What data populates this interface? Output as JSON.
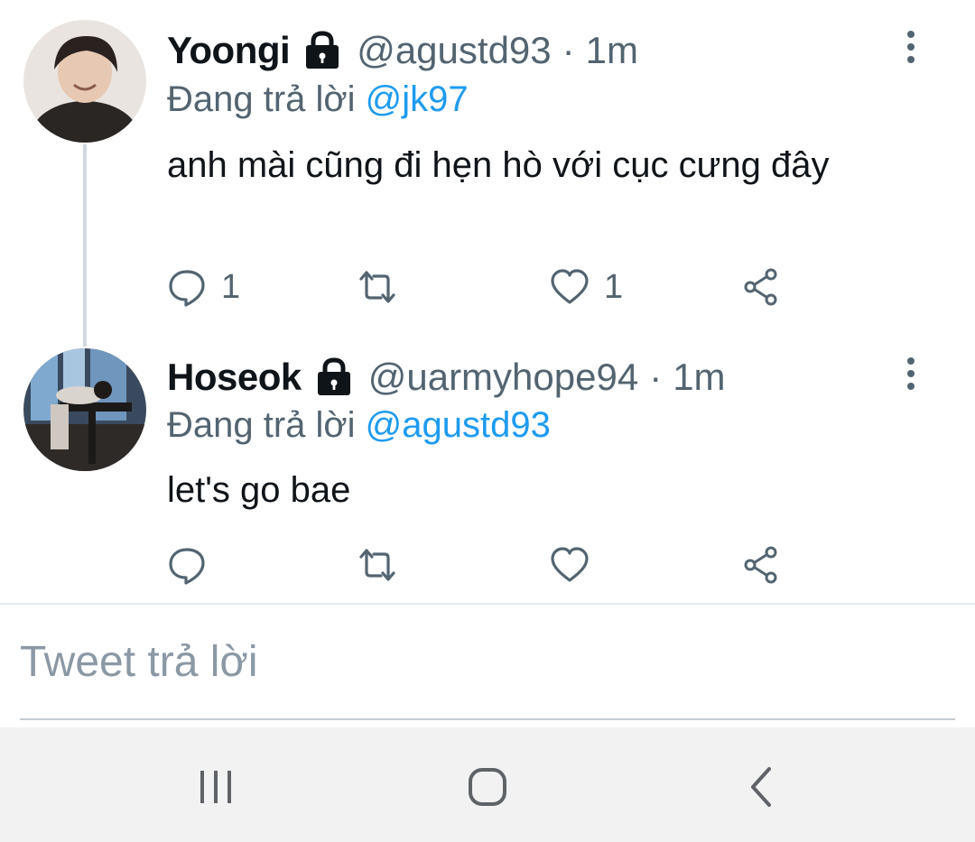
{
  "thread": [
    {
      "display_name": "Yoongi",
      "handle": "@agustd93",
      "separator": "·",
      "time": "1m",
      "reply_prefix": "Đang trả lời",
      "reply_to": "@jk97",
      "text": "anh mài cũng đi hẹn hò với cục cưng đây",
      "reply_count": "1",
      "retweet_count": "",
      "like_count": "1",
      "protected_icon": "lock-icon",
      "more_icon": "more-vertical-icon"
    },
    {
      "display_name": "Hoseok",
      "handle": "@uarmyhope94",
      "separator": "·",
      "time": "1m",
      "reply_prefix": "Đang trả lời",
      "reply_to": "@agustd93",
      "text": "let's go bae",
      "reply_count": "",
      "retweet_count": "",
      "like_count": "",
      "protected_icon": "lock-icon",
      "more_icon": "more-vertical-icon"
    }
  ],
  "composer": {
    "placeholder": "Tweet trả lời",
    "value": ""
  },
  "navbar": {
    "recents_icon": "recents-icon",
    "home_icon": "home-icon",
    "back_icon": "back-icon"
  },
  "colors": {
    "primary_text": "#0f1419",
    "secondary_text": "#536471",
    "mention": "#1d9bf0",
    "thread_line": "#cfd9de",
    "nav_background": "#f2f2f2"
  }
}
